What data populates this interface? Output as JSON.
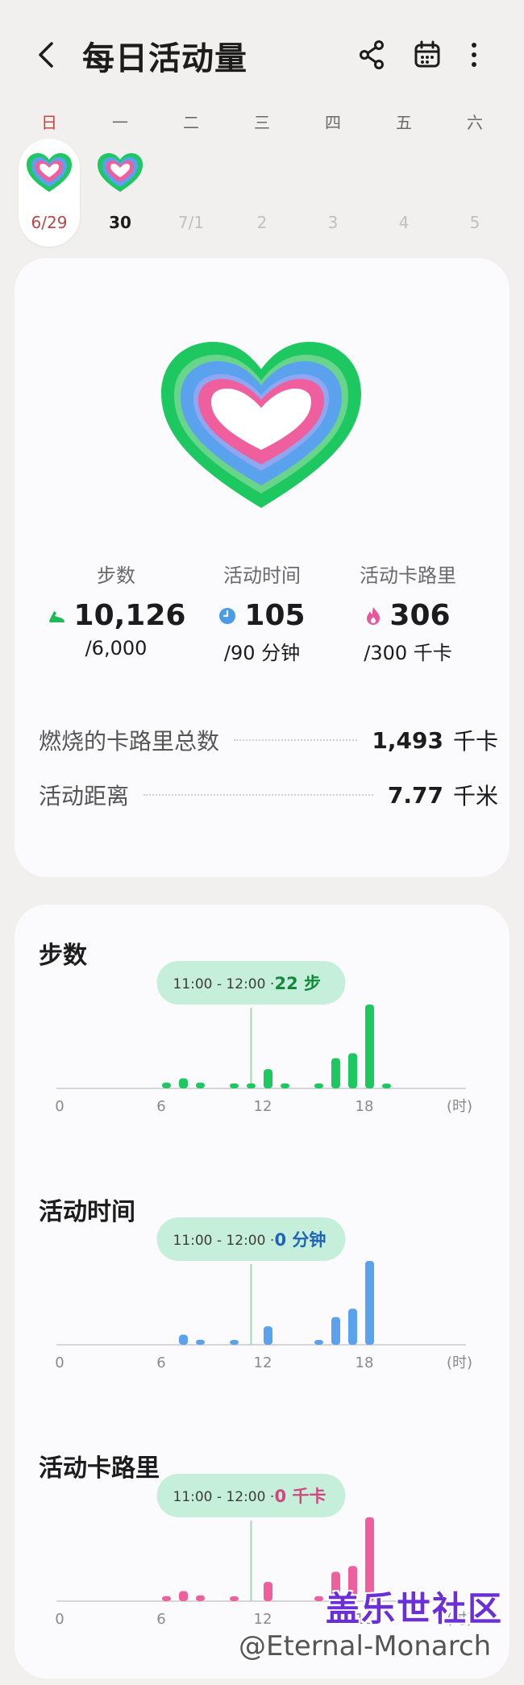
{
  "header": {
    "title": "每日活动量",
    "back_icon": "chevron-left-icon",
    "share_icon": "share-icon",
    "calendar_icon": "calendar-icon",
    "more_icon": "more-vertical-icon"
  },
  "week": {
    "weekdays": [
      "日",
      "一",
      "二",
      "三",
      "四",
      "五",
      "六"
    ],
    "dates": [
      "6/29",
      "30",
      "7/1",
      "2",
      "3",
      "4",
      "5"
    ],
    "selected_index": 0
  },
  "summary": {
    "steps": {
      "label": "步数",
      "value": "10,126",
      "goal": "/6,000",
      "color": "#1db954",
      "icon": "shoe-icon"
    },
    "active_time": {
      "label": "活动时间",
      "value": "105",
      "goal": "/90 分钟",
      "color": "#4a9be8",
      "icon": "clock-icon"
    },
    "active_calories": {
      "label": "活动卡路里",
      "value": "306",
      "goal": "/300 千卡",
      "color": "#e8579a",
      "icon": "flame-icon"
    },
    "total_calories": {
      "label": "燃烧的卡路里总数",
      "value": "1,493",
      "unit": "千卡"
    },
    "distance": {
      "label": "活动距离",
      "value": "7.77",
      "unit": "千米"
    }
  },
  "colors": {
    "steps": "#1ec860",
    "time": "#5aa2ee",
    "calories": "#ef5f9e",
    "tooltip_bg": "#c6efdb"
  },
  "charts": [
    {
      "title": "步数",
      "tooltip_time": "11:00 - 12:00",
      "tooltip_value": "22 步",
      "color": "#1ec860",
      "value_color": "#118a3c"
    },
    {
      "title": "活动时间",
      "tooltip_time": "11:00 - 12:00",
      "tooltip_value": "0 分钟",
      "color": "#5aa2ee",
      "value_color": "#1f63b8"
    },
    {
      "title": "活动卡路里",
      "tooltip_time": "11:00 - 12:00",
      "tooltip_value": "0 千卡",
      "color": "#ef5f9e",
      "value_color": "#d2467e"
    }
  ],
  "chart_data": [
    {
      "type": "bar",
      "title": "步数",
      "x": [
        6,
        7,
        8,
        10,
        11,
        12,
        13,
        15,
        16,
        17,
        18,
        19
      ],
      "values": [
        0.07,
        0.12,
        0.07,
        0.06,
        0.06,
        0.23,
        0.06,
        0.06,
        0.36,
        0.42,
        1.0,
        0.05
      ],
      "xlim": [
        0,
        24
      ],
      "xticks": [
        "0",
        "6",
        "12",
        "18",
        "(时)"
      ],
      "highlight_hour": 11
    },
    {
      "type": "bar",
      "title": "活动时间",
      "x": [
        7,
        8,
        10,
        12,
        15,
        16,
        17,
        18
      ],
      "values": [
        0.12,
        0.06,
        0.05,
        0.22,
        0.05,
        0.33,
        0.43,
        1.0
      ],
      "xlim": [
        0,
        24
      ],
      "xticks": [
        "0",
        "6",
        "12",
        "18",
        "(时)"
      ],
      "highlight_hour": 11
    },
    {
      "type": "bar",
      "title": "活动卡路里",
      "x": [
        6,
        7,
        8,
        10,
        12,
        15,
        16,
        17,
        18
      ],
      "values": [
        0.06,
        0.12,
        0.07,
        0.05,
        0.23,
        0.06,
        0.35,
        0.42,
        1.0
      ],
      "xlim": [
        0,
        24
      ],
      "xticks": [
        "0",
        "6",
        "12",
        "18",
        "(时)"
      ],
      "highlight_hour": 11
    }
  ],
  "watermark": {
    "line1": "盖乐世社区",
    "line2": "@Eternal-Monarch"
  }
}
